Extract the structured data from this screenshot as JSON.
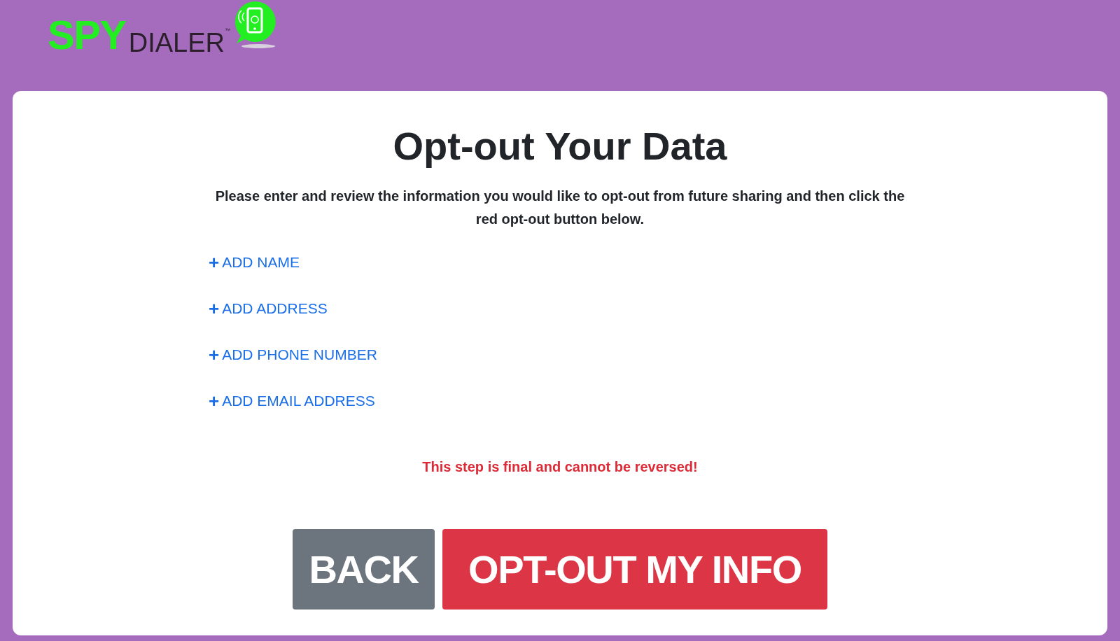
{
  "logo": {
    "part_1": "SPY",
    "part_2": "DIALER",
    "trademark": "™"
  },
  "title": "Opt-out Your Data",
  "intro": "Please enter and review the information you would like to opt-out from future sharing and then click the red opt-out button below.",
  "add_links": [
    {
      "icon": "+",
      "label": "ADD NAME"
    },
    {
      "icon": "+",
      "label": "ADD ADDRESS"
    },
    {
      "icon": "+",
      "label": "ADD PHONE NUMBER"
    },
    {
      "icon": "+",
      "label": "ADD EMAIL ADDRESS"
    }
  ],
  "warning": "This step is final and cannot be reversed!",
  "buttons": [
    {
      "kind": "secondary",
      "label": "BACK"
    },
    {
      "kind": "danger",
      "label": "OPT-OUT MY INFO"
    }
  ]
}
